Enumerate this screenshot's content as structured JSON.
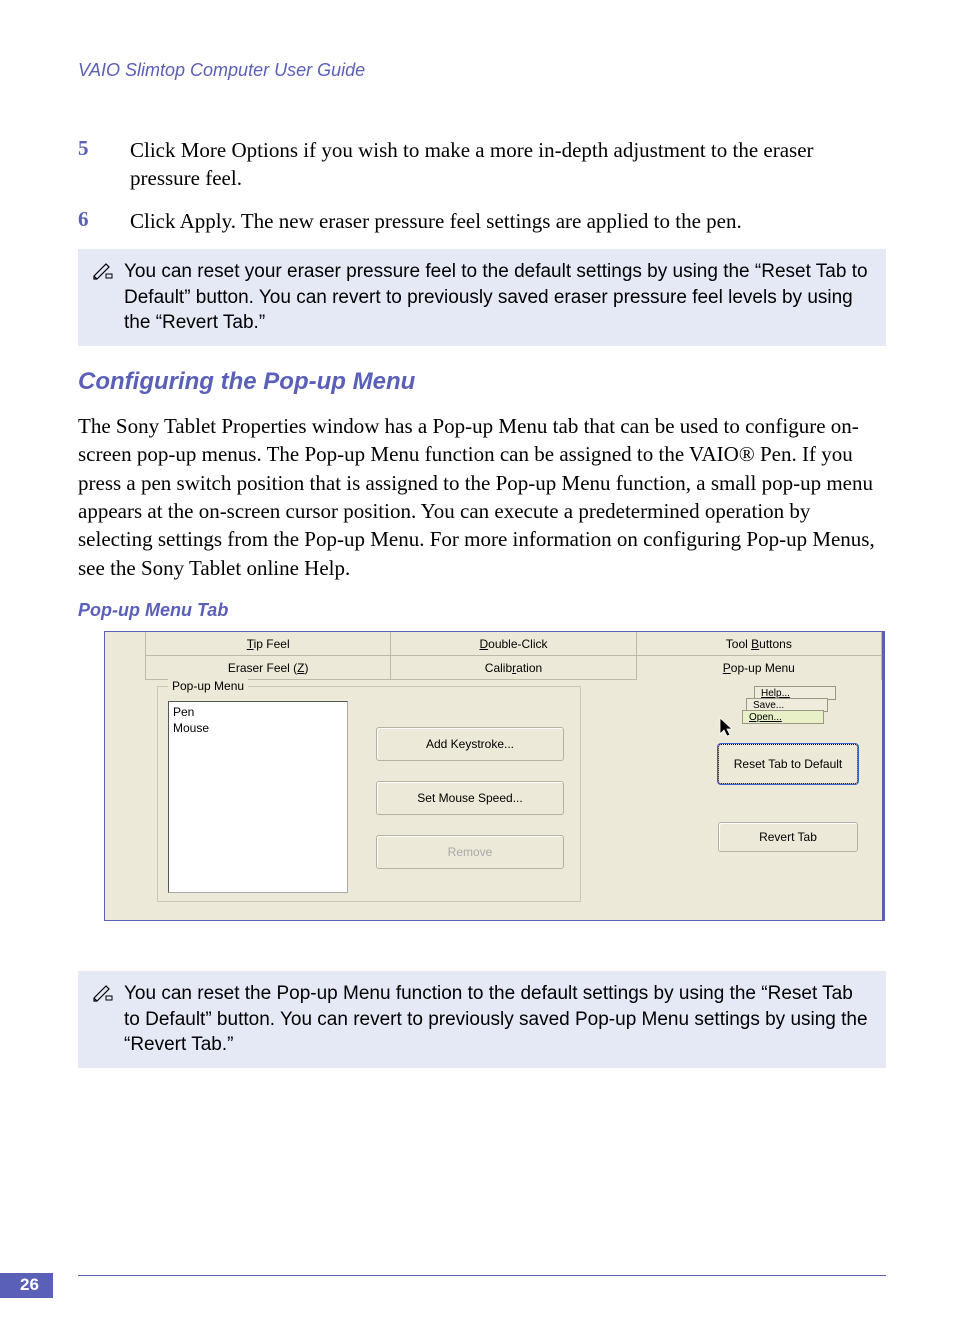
{
  "header": {
    "guide_title": "VAIO Slimtop Computer User Guide"
  },
  "steps": [
    {
      "num": "5",
      "text": "Click More Options if you wish to make a more in-depth adjustment to the eraser pressure feel."
    },
    {
      "num": "6",
      "text": "Click Apply. The new eraser pressure feel settings are applied to the pen."
    }
  ],
  "note1": "You can reset your eraser pressure feel to the default settings by using the “Reset Tab to Default” button. You can revert to previously saved eraser pressure feel levels by using the “Revert Tab.”",
  "section": {
    "title": "Configuring the Pop-up Menu",
    "paragraph": "The Sony Tablet Properties window has a Pop-up Menu tab that can be used to configure on-screen pop-up menus. The Pop-up Menu function can be assigned to the VAIO® Pen. If you press a pen switch position that is assigned to the Pop-up Menu function, a small pop-up menu appears at the on-screen cursor position. You can execute a predetermined operation by selecting settings from the Pop-up Menu. For more information on configuring Pop-up Menus, see the Sony Tablet online Help."
  },
  "figure_caption": "Pop-up Menu Tab",
  "dialog": {
    "tabs_top": {
      "tip_feel": "Tip Feel",
      "double_click": "Double-Click",
      "tool_buttons": "Tool Buttons"
    },
    "tabs_bottom": {
      "eraser": "Eraser Feel (Z)",
      "calibration": "Calibration",
      "popup": "Pop-up Menu"
    },
    "group_title": "Pop-up Menu",
    "list": {
      "item1": "Pen",
      "item2": "Mouse"
    },
    "buttons": {
      "add_keystroke": "Add Keystroke...",
      "set_mouse_speed": "Set Mouse Speed...",
      "remove": "Remove"
    },
    "side": {
      "help": "Help...",
      "save": "Save...",
      "open": "Open...",
      "reset": "Reset Tab to Default",
      "revert": "Revert Tab"
    }
  },
  "note2": "You can reset the Pop-up Menu function to the default settings by using the “Reset Tab to Default” button. You can revert to previously saved Pop-up Menu settings by using the “Revert Tab.”",
  "page_number": "26"
}
